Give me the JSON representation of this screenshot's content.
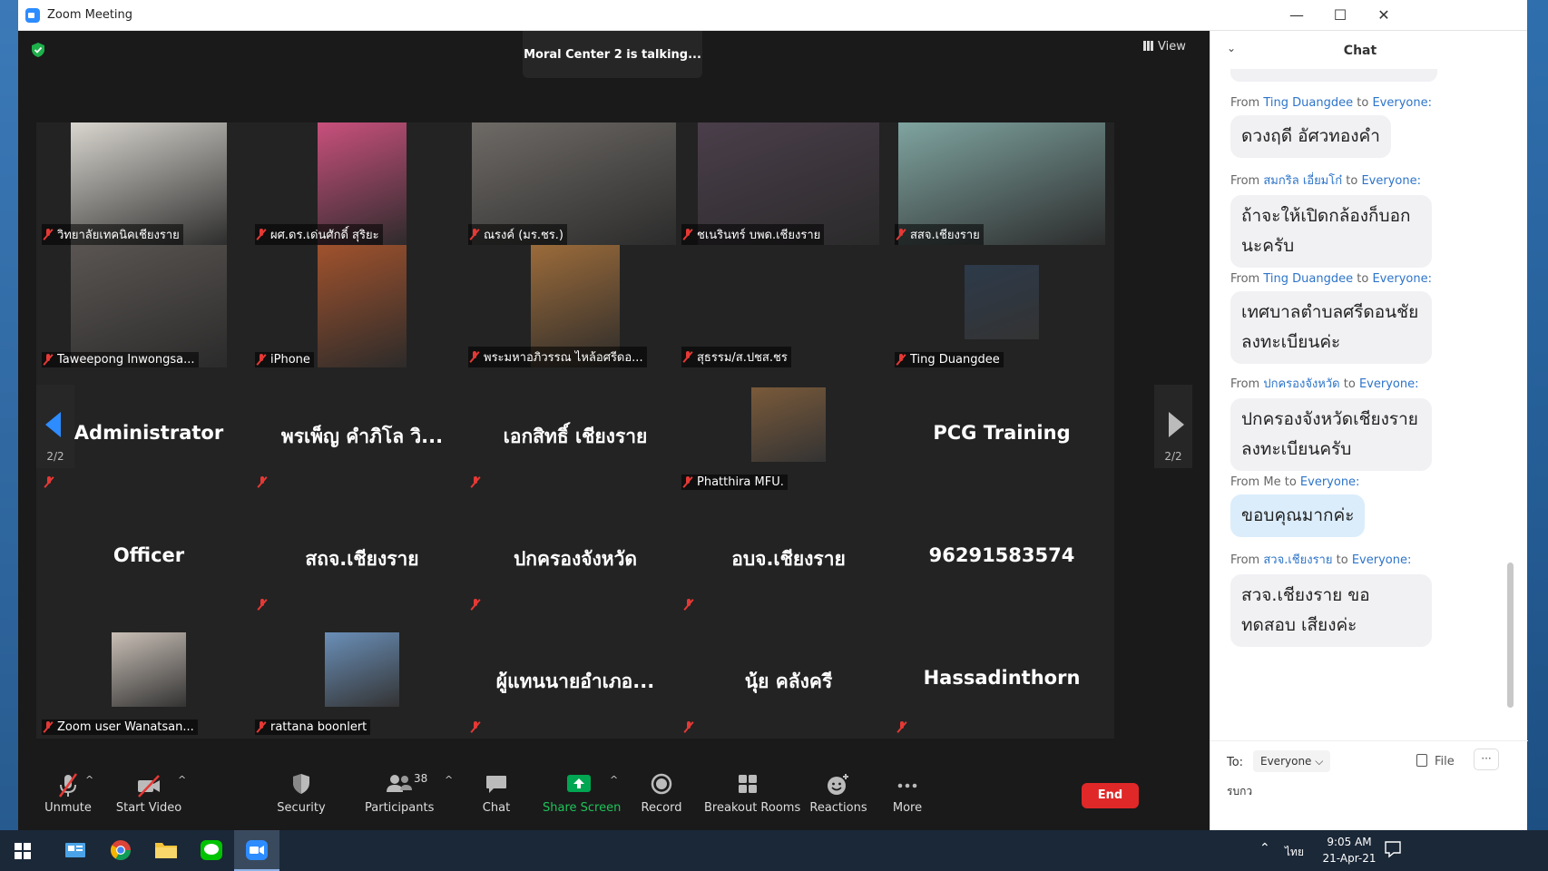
{
  "window": {
    "title": "Zoom Meeting",
    "minimize": "—",
    "maximize": "☐",
    "close": "✕"
  },
  "meeting": {
    "talking_indicator": "Moral Center 2 is talking...",
    "view_label": "View",
    "page_indicator_left": "2/2",
    "page_indicator_right": "2/2",
    "tiles": [
      {
        "label": "วิทยาลัยเทคนิคเชียงราย",
        "type": "video",
        "bg": "#d9d6cf"
      },
      {
        "label": "ผศ.ดร.เด่นศักดิ์ สุริยะ",
        "type": "video",
        "bg": "#c9507c"
      },
      {
        "label": "ณรงค์ (มร.ชร.)",
        "type": "video",
        "bg": "#6e6a66"
      },
      {
        "label": "ชเนรินทร์ บพด.เชียงราย",
        "type": "video",
        "bg": "#4a3e4a"
      },
      {
        "label": "สสจ.เชียงราย",
        "type": "video",
        "bg": "#7fa4a0"
      },
      {
        "label": "Taweepong Inwongsa...",
        "type": "video",
        "bg": "#5a5552"
      },
      {
        "label": "iPhone",
        "type": "video",
        "bg": "#a0522d"
      },
      {
        "label": "พระมหาอภิวรรณ ไหล้อศรีดอ...",
        "type": "video",
        "bg": "#9b6b3a"
      },
      {
        "label": "สุธรรม/ส.ปชส.ชร",
        "type": "blank"
      },
      {
        "label": "Ting Duangdee",
        "type": "avatar",
        "bg": "#2d3a4a"
      },
      {
        "bigname": "Administrator",
        "type": "name"
      },
      {
        "bigname": "พรเพ็ญ คำภิโล วิ...",
        "type": "name"
      },
      {
        "bigname": "เอกสิทธิ์ เชียงราย",
        "type": "name"
      },
      {
        "label": "Phatthira MFU.",
        "type": "avatar",
        "bg": "#7a5a3a"
      },
      {
        "bigname": "PCG Training",
        "type": "name"
      },
      {
        "bigname": "Officer",
        "type": "name"
      },
      {
        "bigname": "สถจ.เชียงราย",
        "type": "name"
      },
      {
        "bigname": "ปกครองจังหวัด",
        "type": "name"
      },
      {
        "bigname": "อบจ.เชียงราย",
        "type": "name"
      },
      {
        "bigname": "96291583574",
        "type": "name"
      },
      {
        "label": "Zoom user Wanatsan...",
        "type": "avatar",
        "bg": "#c9bfb6"
      },
      {
        "label": "rattana boonlert",
        "type": "avatar",
        "bg": "#6a8fb8"
      },
      {
        "bigname": "ผู้แทนนายอำเภอ...",
        "type": "name"
      },
      {
        "bigname": "นุ้ย คลังครี",
        "type": "name"
      },
      {
        "bigname": "Hassadinthorn",
        "type": "name"
      }
    ]
  },
  "toolbar": {
    "unmute": "Unmute",
    "start_video": "Start Video",
    "security": "Security",
    "participants": "Participants",
    "participants_count": "38",
    "chat": "Chat",
    "share_screen": "Share Screen",
    "record": "Record",
    "breakout_rooms": "Breakout Rooms",
    "reactions": "Reactions",
    "more": "More",
    "end": "End"
  },
  "chat": {
    "title": "Chat",
    "messages": [
      {
        "from": "Ting Duangdee",
        "to": "Everyone:",
        "text": "ดวงฤดี อัศวทองคำ"
      },
      {
        "from": "สมกริล เอี่ยมโก๋",
        "to": "Everyone:",
        "text": "ถ้าจะให้เปิดกล้องก็บอก นะครับ"
      },
      {
        "from": "Ting Duangdee",
        "to": "Everyone:",
        "text": "เทศบาลตำบลศรีดอนชัย ลงทะเบียนค่ะ"
      },
      {
        "from": "ปกครองจังหวัด",
        "to": "Everyone:",
        "text": "ปกครองจังหวัดเชียงราย ลงทะเบียนครับ"
      },
      {
        "from": "Me",
        "to": "Everyone:",
        "text": "ขอบคุณมากค่ะ"
      },
      {
        "from": "สวจ.เชียงราย",
        "to": "Everyone:",
        "text": "สวจ.เชียงราย ขอทดสอบ เสียงค่ะ"
      }
    ],
    "from_word": "From",
    "to_word": "to",
    "to_label": "To:",
    "to_value": "Everyone",
    "file_label": "File",
    "more_label": "···",
    "input_value": "รบกว"
  },
  "taskbar": {
    "time": "9:05 AM",
    "date": "21-Apr-21",
    "lang": "ไทย"
  },
  "colors": {
    "accent": "#2d8cff",
    "end": "#e02828",
    "share": "#00a651",
    "muted": "#e53935"
  }
}
